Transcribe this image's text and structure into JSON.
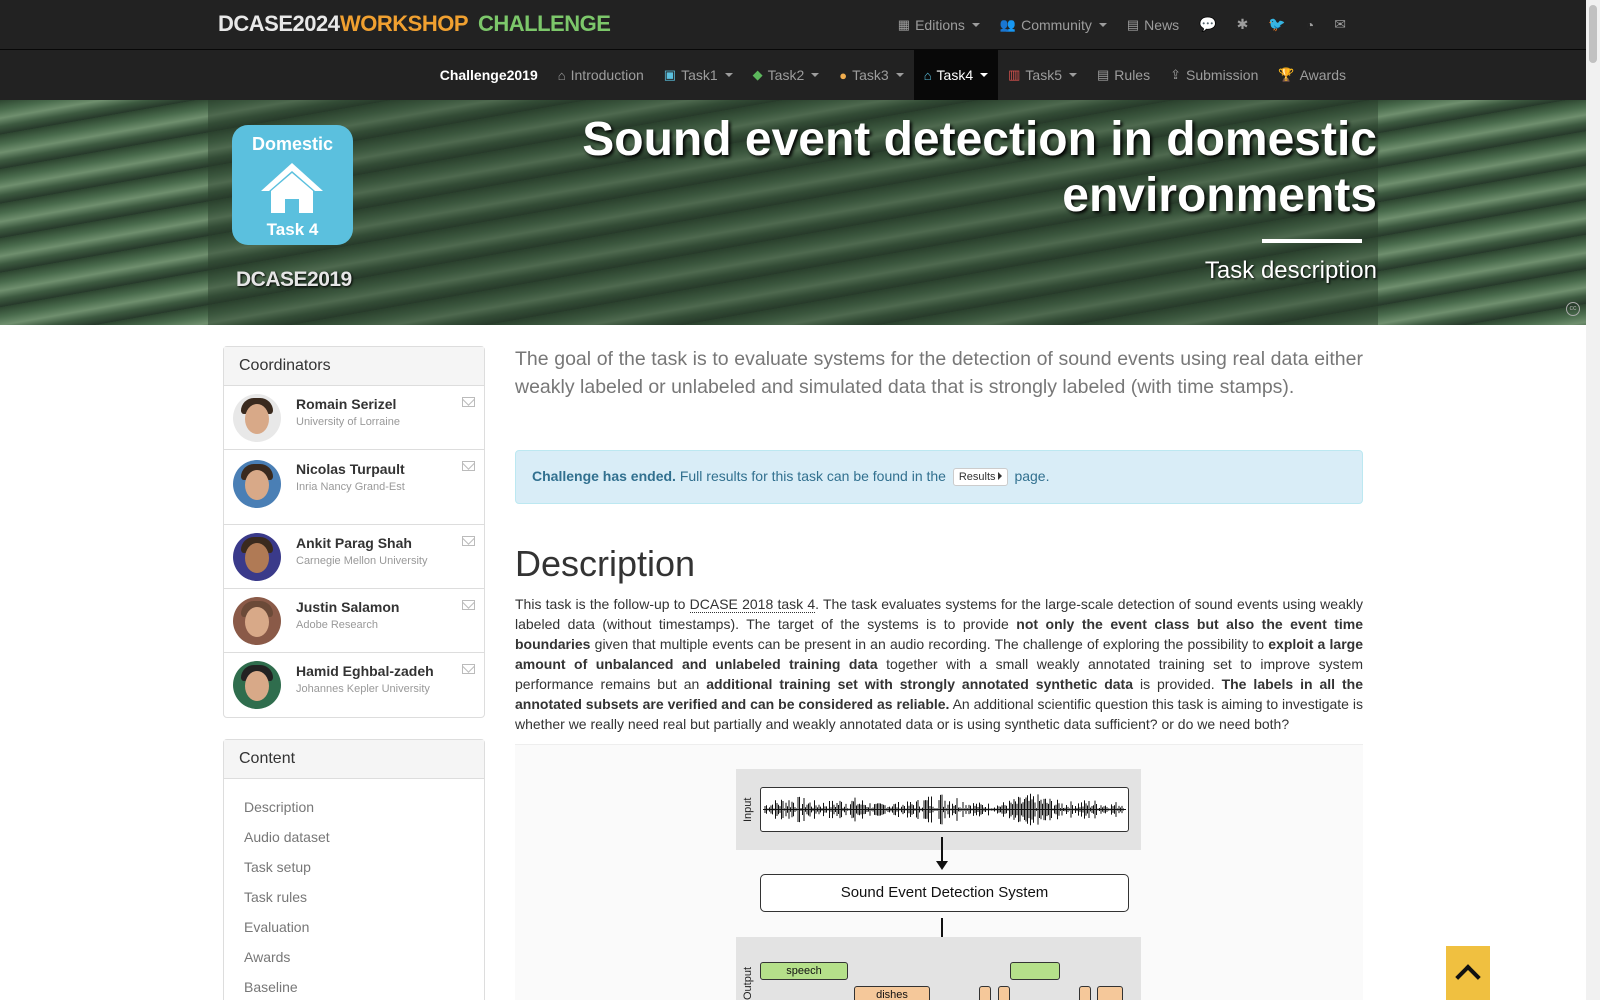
{
  "brand": {
    "dcase": "DCASE2024",
    "workshop": "WORKSHOP",
    "challenge": "CHALLENGE"
  },
  "topnav": {
    "editions": "Editions",
    "community": "Community",
    "news": "News",
    "icons": [
      "comments-icon",
      "slack-icon",
      "twitter-icon",
      "github-icon",
      "envelope-icon"
    ]
  },
  "subnav": {
    "home": "Challenge2019",
    "items": [
      "Introduction",
      "Task1",
      "Task2",
      "Task3",
      "Task4",
      "Task5",
      "Rules",
      "Submission",
      "Awards"
    ]
  },
  "hero": {
    "badge_top": "Domestic",
    "badge_bottom": "Task 4",
    "logo": "DCASE2019",
    "title": "Sound event detection in domestic environments",
    "subtitle": "Task description"
  },
  "coordinators": {
    "heading": "Coordinators",
    "people": [
      {
        "name": "Romain Serizel",
        "affiliation": "University of Lorraine"
      },
      {
        "name": "Nicolas Turpault",
        "affiliation": "Inria Nancy Grand-Est"
      },
      {
        "name": "Ankit Parag Shah",
        "affiliation": "Carnegie Mellon University"
      },
      {
        "name": "Justin Salamon",
        "affiliation": "Adobe Research"
      },
      {
        "name": "Hamid Eghbal-zadeh",
        "affiliation": "Johannes Kepler University"
      }
    ]
  },
  "content": {
    "heading": "Content",
    "items": [
      "Description",
      "Audio dataset",
      "Task setup",
      "Task rules",
      "Evaluation",
      "Awards",
      "Baseline"
    ]
  },
  "lead": "The goal of the task is to evaluate systems for the detection of sound events using real data either weakly labeled or unlabeled and simulated data that is strongly labeled (with time stamps).",
  "alert": {
    "strong": "Challenge has ended.",
    "text": "Full results for this task can be found in the",
    "button": "Results",
    "tail": "page."
  },
  "description": {
    "heading": "Description",
    "p_parts": [
      "This task is the follow-up to ",
      "DCASE 2018 task 4",
      ". The task evaluates systems for the large-scale detection of sound events using weakly labeled data (without timestamps). The target of the systems is to provide ",
      "not only the event class but also the event time boundaries",
      " given that multiple events can be present in an audio recording. The challenge of exploring the possibility to ",
      "exploit a large amount of unbalanced and unlabeled training data",
      " together with a small weakly annotated training set to improve system performance remains but an ",
      "additional training set with strongly annotated synthetic data",
      " is provided. ",
      "The labels in all the annotated subsets are verified and can be considered as reliable.",
      " An additional scientific question this task is aiming to investigate is whether we really need real but partially and weakly annotated data or is using synthetic data sufficient? or do we need both?"
    ]
  },
  "figure": {
    "input_label": "Input",
    "system_label": "Sound Event Detection System",
    "output_label": "Output",
    "events": [
      "speech",
      "dishes"
    ]
  },
  "colors": {
    "accent": "#5bc0de",
    "navbar": "#222222",
    "alert_bg": "#d9edf7",
    "event_green": "#b5e08a",
    "event_orange": "#f5c89a"
  }
}
